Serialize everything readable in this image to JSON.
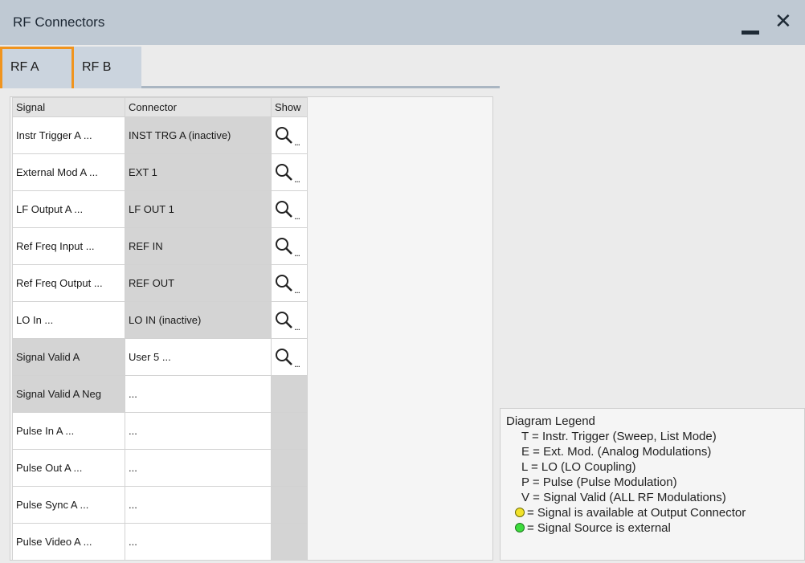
{
  "window": {
    "title": "RF Connectors"
  },
  "tabs": [
    {
      "label": "RF A",
      "active": true
    },
    {
      "label": "RF B",
      "active": false
    }
  ],
  "table": {
    "headers": {
      "signal": "Signal",
      "connector": "Connector",
      "show": "Show"
    },
    "rows": [
      {
        "signal": "Instr Trigger A ...",
        "connector": "INST TRG A (inactive)",
        "show_icon": "search-icon",
        "show_suffix": "..."
      },
      {
        "signal": "External Mod A ...",
        "connector": "EXT 1",
        "show_icon": "search-icon",
        "show_suffix": "..."
      },
      {
        "signal": "LF Output A ...",
        "connector": "LF OUT 1",
        "show_icon": "search-icon",
        "show_suffix": "..."
      },
      {
        "signal": "Ref Freq Input ...",
        "connector": "REF IN",
        "show_icon": "search-icon",
        "show_suffix": "..."
      },
      {
        "signal": "Ref Freq Output ...",
        "connector": "REF OUT",
        "show_icon": "search-icon",
        "show_suffix": "..."
      },
      {
        "signal": "LO In ...",
        "connector": "LO IN (inactive)",
        "show_icon": "search-icon",
        "show_suffix": "..."
      },
      {
        "signal": "Signal Valid A",
        "connector": "User 5 ...",
        "show_icon": "search-icon",
        "show_suffix": "..."
      },
      {
        "signal": "Signal Valid A Neg",
        "connector": "..."
      },
      {
        "signal": "Pulse In A ...",
        "connector": "..."
      },
      {
        "signal": "Pulse Out A ...",
        "connector": "..."
      },
      {
        "signal": "Pulse Sync A ...",
        "connector": "..."
      },
      {
        "signal": "Pulse Video A ...",
        "connector": "..."
      }
    ]
  },
  "legend": {
    "title": "Diagram Legend",
    "items": [
      "T = Instr. Trigger (Sweep, List Mode)",
      "E = Ext. Mod. (Analog Modulations)",
      "L = LO (LO Coupling)",
      "P = Pulse (Pulse Modulation)",
      "V = Signal Valid (ALL RF Modulations)"
    ],
    "dot_items": [
      {
        "color": "#f2e22a",
        "text": "= Signal is available at Output Connector"
      },
      {
        "color": "#3ddc3d",
        "text": "= Signal Source is external"
      }
    ]
  },
  "colors": {
    "active_tab_border": "#f0941e",
    "titlebar": "#bfc9d3"
  }
}
